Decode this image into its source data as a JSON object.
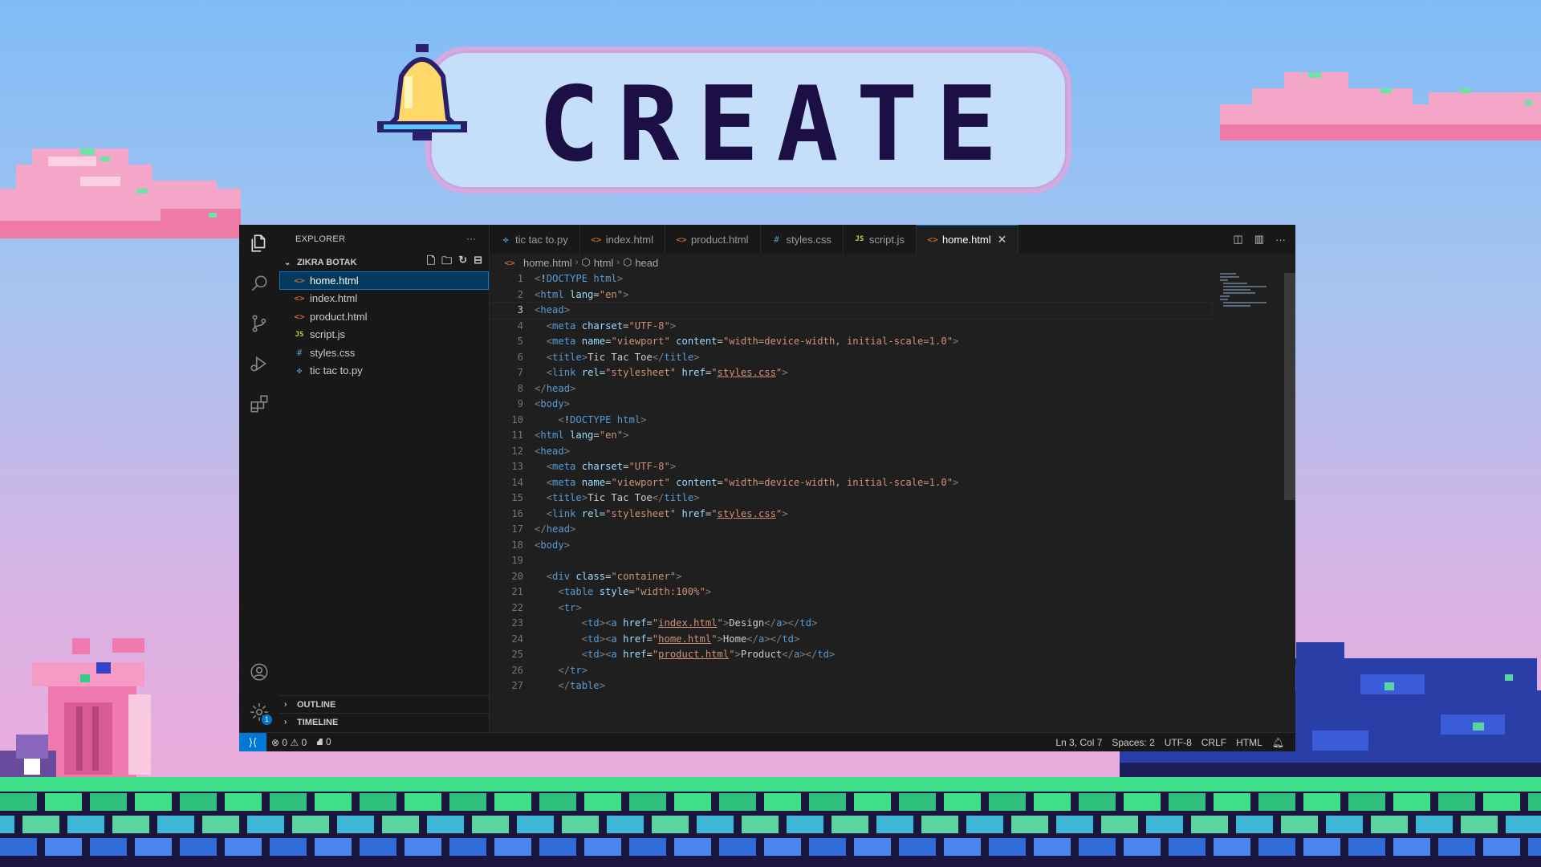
{
  "banner": {
    "title": "CREATE"
  },
  "explorer": {
    "header": "EXPLORER",
    "more": "···",
    "folder": "ZIKRA BOTAK",
    "files": [
      {
        "name": "home.html",
        "type": "html",
        "icon": "<>"
      },
      {
        "name": "index.html",
        "type": "html",
        "icon": "<>"
      },
      {
        "name": "product.html",
        "type": "html",
        "icon": "<>"
      },
      {
        "name": "script.js",
        "type": "js",
        "icon": "JS"
      },
      {
        "name": "styles.css",
        "type": "css",
        "icon": "#"
      },
      {
        "name": "tic tac to.py",
        "type": "py",
        "icon": "✤"
      }
    ],
    "outline": "OUTLINE",
    "timeline": "TIMELINE"
  },
  "tabs": [
    {
      "label": "tic tac to.py",
      "icon": "✤",
      "type": "py"
    },
    {
      "label": "index.html",
      "icon": "<>",
      "type": "html"
    },
    {
      "label": "product.html",
      "icon": "<>",
      "type": "html"
    },
    {
      "label": "styles.css",
      "icon": "#",
      "type": "css"
    },
    {
      "label": "script.js",
      "icon": "JS",
      "type": "js"
    },
    {
      "label": "home.html",
      "icon": "<>",
      "type": "html",
      "close": "✕"
    }
  ],
  "breadcrumb": {
    "file": "home.html",
    "el1": "html",
    "el2": "head"
  },
  "code_lines": [
    "<!DOCTYPE html>",
    "<html lang=\"en\">",
    "<head>",
    "  <meta charset=\"UTF-8\">",
    "  <meta name=\"viewport\" content=\"width=device-width, initial-scale=1.0\">",
    "  <title>Tic Tac Toe</title>",
    "  <link rel=\"stylesheet\" href=\"styles.css\">",
    "</head>",
    "<body>",
    "    <!DOCTYPE html>",
    "<html lang=\"en\">",
    "<head>",
    "  <meta charset=\"UTF-8\">",
    "  <meta name=\"viewport\" content=\"width=device-width, initial-scale=1.0\">",
    "  <title>Tic Tac Toe</title>",
    "  <link rel=\"stylesheet\" href=\"styles.css\">",
    "</head>",
    "<body>",
    "",
    "  <div class=\"container\">",
    "    <table style=\"width:100%\">",
    "    <tr>",
    "        <td><a href=\"index.html\">Design</a></td>",
    "        <td><a href=\"home.html\">Home</a></td>",
    "        <td><a href=\"product.html\">Product</a></td>",
    "    </tr>",
    "    </table>"
  ],
  "current_line": 3,
  "status": {
    "errors": "0",
    "warnings": "0",
    "ports": "0",
    "position": "Ln 3, Col 7",
    "spaces": "Spaces: 2",
    "encoding": "UTF-8",
    "eol": "CRLF",
    "language": "HTML"
  },
  "settings_badge": "1"
}
